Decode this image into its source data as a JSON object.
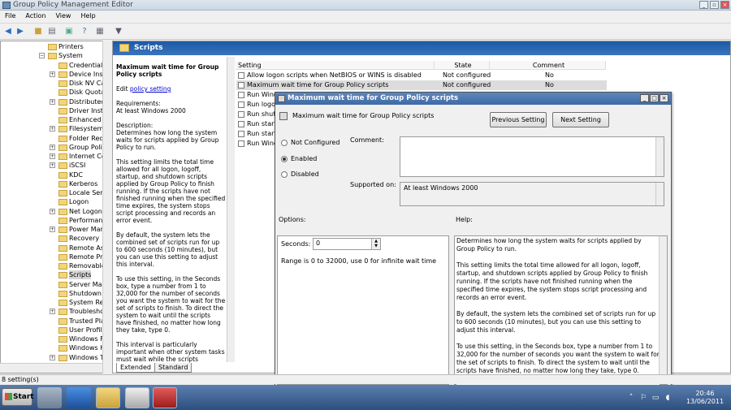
{
  "app": {
    "title": "Group Policy Management Editor"
  },
  "menu": [
    "File",
    "Action",
    "View",
    "Help"
  ],
  "tree": {
    "items": [
      {
        "label": "Printers",
        "indent": 0,
        "expand": ""
      },
      {
        "label": "System",
        "indent": -1,
        "expand": "−"
      },
      {
        "label": "Credentials",
        "indent": 1,
        "expand": ""
      },
      {
        "label": "Device Insta",
        "indent": 1,
        "expand": "+"
      },
      {
        "label": "Disk NV Cac",
        "indent": 1,
        "expand": ""
      },
      {
        "label": "Disk Quotas",
        "indent": 1,
        "expand": ""
      },
      {
        "label": "Distributed",
        "indent": 1,
        "expand": "+"
      },
      {
        "label": "Driver Insta",
        "indent": 1,
        "expand": ""
      },
      {
        "label": "Enhanced S",
        "indent": 1,
        "expand": ""
      },
      {
        "label": "Filesystem",
        "indent": 1,
        "expand": "+"
      },
      {
        "label": "Folder Redir",
        "indent": 1,
        "expand": ""
      },
      {
        "label": "Group Polic",
        "indent": 1,
        "expand": "+"
      },
      {
        "label": "Internet Co",
        "indent": 1,
        "expand": "+"
      },
      {
        "label": "iSCSI",
        "indent": 1,
        "expand": "+"
      },
      {
        "label": "KDC",
        "indent": 1,
        "expand": ""
      },
      {
        "label": "Kerberos",
        "indent": 1,
        "expand": ""
      },
      {
        "label": "Locale Serv",
        "indent": 1,
        "expand": ""
      },
      {
        "label": "Logon",
        "indent": 1,
        "expand": ""
      },
      {
        "label": "Net Logon",
        "indent": 1,
        "expand": "+"
      },
      {
        "label": "Performanc",
        "indent": 1,
        "expand": ""
      },
      {
        "label": "Power Mana",
        "indent": 1,
        "expand": "+"
      },
      {
        "label": "Recovery",
        "indent": 1,
        "expand": ""
      },
      {
        "label": "Remote Ass",
        "indent": 1,
        "expand": ""
      },
      {
        "label": "Remote Pro",
        "indent": 1,
        "expand": ""
      },
      {
        "label": "Removable",
        "indent": 1,
        "expand": ""
      },
      {
        "label": "Scripts",
        "indent": 1,
        "expand": "",
        "selected": true
      },
      {
        "label": "Server Man",
        "indent": 1,
        "expand": ""
      },
      {
        "label": "Shutdown C",
        "indent": 1,
        "expand": ""
      },
      {
        "label": "System Res",
        "indent": 1,
        "expand": ""
      },
      {
        "label": "Troublesho",
        "indent": 1,
        "expand": "+"
      },
      {
        "label": "Trusted Pla",
        "indent": 1,
        "expand": ""
      },
      {
        "label": "User Profile",
        "indent": 1,
        "expand": ""
      },
      {
        "label": "Windows Fil",
        "indent": 1,
        "expand": ""
      },
      {
        "label": "Windows Ho",
        "indent": 1,
        "expand": ""
      },
      {
        "label": "Windows Ti",
        "indent": 1,
        "expand": "+"
      }
    ]
  },
  "panel": {
    "header": "Scripts"
  },
  "description": {
    "title": "Maximum wait time for Group Policy scripts",
    "edit_prefix": "Edit ",
    "edit_link": "policy setting",
    "requirements_label": "Requirements:",
    "requirements_value": "At least Windows 2000",
    "description_label": "Description:",
    "p1": "Determines how long the system waits for scripts applied by Group Policy to run.",
    "p2": "This setting limits the total time allowed for all logon, logoff, startup, and shutdown scripts applied by Group Policy to finish running. If the scripts have not finished running when the specified time expires, the system stops script processing and records an error event.",
    "p3": "By default, the system lets the combined set of scripts run for up to 600 seconds (10 minutes), but you can use this setting to adjust this interval.",
    "p4": "To use this setting, in the Seconds box, type a number from 1 to 32,000 for the number of seconds you want the system to wait for the set of scripts to finish. To direct the system to wait until the scripts have finished, no matter how long they take, type 0.",
    "p5": "This interval is particularly important when other system tasks must wait while the scripts complete. By default, each startup script must complete"
  },
  "tabs": [
    "Extended",
    "Standard"
  ],
  "list": {
    "columns": [
      "Setting",
      "State",
      "Comment"
    ],
    "rows": [
      {
        "setting": "Allow logon scripts when NetBIOS or WINS is disabled",
        "state": "Not configured",
        "comment": "No"
      },
      {
        "setting": "Maximum wait time for Group Policy scripts",
        "state": "Not configured",
        "comment": "No",
        "selected": true
      },
      {
        "setting": "Run Wind",
        "state": "",
        "comment": ""
      },
      {
        "setting": "Run logon",
        "state": "",
        "comment": ""
      },
      {
        "setting": "Run shutd",
        "state": "",
        "comment": ""
      },
      {
        "setting": "Run start",
        "state": "",
        "comment": ""
      },
      {
        "setting": "Run start",
        "state": "",
        "comment": ""
      },
      {
        "setting": "Run Wind",
        "state": "",
        "comment": ""
      }
    ]
  },
  "dialog": {
    "title": "Maximum wait time for Group Policy scripts",
    "policy_name": "Maximum wait time for Group Policy scripts",
    "prev_button": "Previous Setting",
    "next_button": "Next Setting",
    "radio_not_configured": "Not Configured",
    "radio_enabled": "Enabled",
    "radio_disabled": "Disabled",
    "selected_option": "Enabled",
    "comment_label": "Comment:",
    "comment_value": "",
    "supported_label": "Supported on:",
    "supported_value": "At least Windows 2000",
    "options_label": "Options:",
    "help_label": "Help:",
    "seconds_label": "Seconds:",
    "seconds_value": "0",
    "range_text": "Range is 0 to 32000, use 0 for infinite wait time",
    "help_p1": "Determines how long the system waits for scripts applied by Group Policy to run.",
    "help_p2": "This setting limits the total time allowed for all logon, logoff, startup, and shutdown scripts applied by Group Policy to finish running. If the scripts have not finished running when the specified time expires, the system stops script processing and records an error event.",
    "help_p3": "By default, the system lets the combined set of scripts run for up to 600 seconds (10 minutes), but you can use this setting to adjust this interval.",
    "help_p4": "To use this setting, in the Seconds box, type a number from 1 to 32,000 for the number of seconds you want the system to wait for the set of scripts to finish. To direct the system to wait until the scripts have finished, no matter how long they take, type 0."
  },
  "status": {
    "text": "8 setting(s)"
  },
  "taskbar": {
    "start": "Start",
    "time": "20:46",
    "date": "13/06/2011"
  }
}
